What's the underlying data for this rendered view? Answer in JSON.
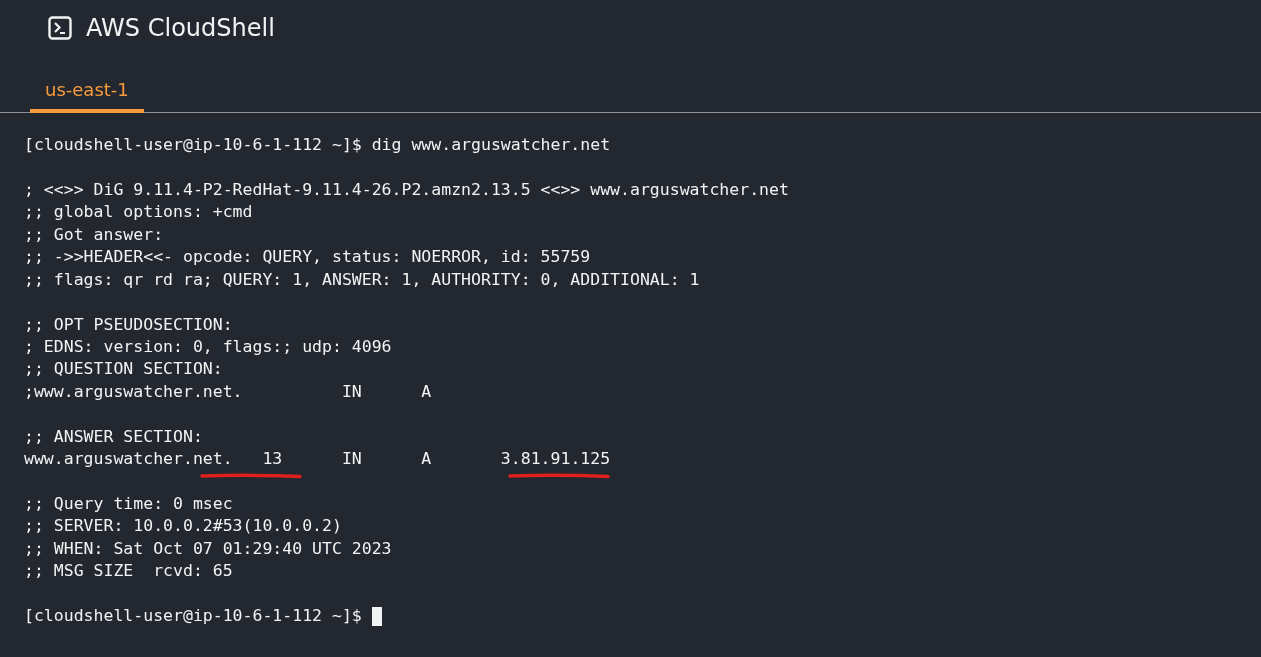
{
  "header": {
    "title": "AWS CloudShell"
  },
  "tabs": [
    {
      "label": "us-east-1",
      "selected": true
    }
  ],
  "terminal": {
    "lines": [
      {
        "kind": "text",
        "text": "[cloudshell-user@ip-10-6-1-112 ~]$ dig www.arguswatcher.net"
      },
      {
        "kind": "blank"
      },
      {
        "kind": "text",
        "text": "; <<>> DiG 9.11.4-P2-RedHat-9.11.4-26.P2.amzn2.13.5 <<>> www.arguswatcher.net"
      },
      {
        "kind": "text",
        "text": ";; global options: +cmd"
      },
      {
        "kind": "text",
        "text": ";; Got answer:"
      },
      {
        "kind": "text",
        "text": ";; ->>HEADER<<- opcode: QUERY, status: NOERROR, id: 55759"
      },
      {
        "kind": "text",
        "text": ";; flags: qr rd ra; QUERY: 1, ANSWER: 1, AUTHORITY: 0, ADDITIONAL: 1"
      },
      {
        "kind": "blank"
      },
      {
        "kind": "text",
        "text": ";; OPT PSEUDOSECTION:"
      },
      {
        "kind": "text",
        "text": "; EDNS: version: 0, flags:; udp: 4096"
      },
      {
        "kind": "text",
        "text": ";; QUESTION SECTION:"
      },
      {
        "kind": "text",
        "text": ";www.arguswatcher.net.          IN      A"
      },
      {
        "kind": "blank"
      },
      {
        "kind": "text",
        "text": ";; ANSWER SECTION:"
      },
      {
        "kind": "parts",
        "parts": [
          {
            "text": "www.arguswatcher.",
            "underlined": false
          },
          {
            "text": "net.   13",
            "underlined": true
          },
          {
            "text": "      IN      A       ",
            "underlined": false
          },
          {
            "text": "3.81.91.125",
            "underlined": true
          }
        ]
      },
      {
        "kind": "blank"
      },
      {
        "kind": "text",
        "text": ";; Query time: 0 msec"
      },
      {
        "kind": "text",
        "text": ";; SERVER: 10.0.0.2#53(10.0.0.2)"
      },
      {
        "kind": "text",
        "text": ";; WHEN: Sat Oct 07 01:29:40 UTC 2023"
      },
      {
        "kind": "text",
        "text": ";; MSG SIZE  rcvd: 65"
      },
      {
        "kind": "blank"
      },
      {
        "kind": "prompt",
        "text": "[cloudshell-user@ip-10-6-1-112 ~]$ "
      }
    ]
  }
}
